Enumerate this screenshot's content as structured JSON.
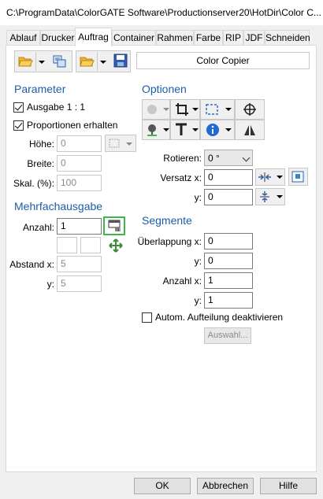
{
  "window": {
    "title": "C:\\ProgramData\\ColorGATE Software\\Productionserver20\\HotDir\\Color C..."
  },
  "tabs": [
    {
      "label": "Ablauf"
    },
    {
      "label": "Drucker"
    },
    {
      "label": "Auftrag"
    },
    {
      "label": "Container"
    },
    {
      "label": "Rahmen"
    },
    {
      "label": "Farbe"
    },
    {
      "label": "RIP"
    },
    {
      "label": "JDF"
    },
    {
      "label": "Schneiden"
    }
  ],
  "active_tab": "Auftrag",
  "toolbar": {
    "name_field": "Color Copier"
  },
  "parameter": {
    "heading": "Parameter",
    "ausgabe_label": "Ausgabe 1 : 1",
    "ausgabe_checked": true,
    "proportionen_label": "Proportionen erhalten",
    "proportionen_checked": true,
    "hoehe_label": "Höhe:",
    "hoehe_value": "0",
    "breite_label": "Breite:",
    "breite_value": "0",
    "skal_label": "Skal. (%):",
    "skal_value": "100"
  },
  "mehrfach": {
    "heading": "Mehrfachausgabe",
    "anzahl_label": "Anzahl:",
    "anzahl_value": "1",
    "abstand_x_label": "Abstand x:",
    "abstand_x_value": "5",
    "y_label": "y:",
    "y_value": "5"
  },
  "optionen": {
    "heading": "Optionen",
    "rotieren_label": "Rotieren:",
    "rotieren_value": "0 °",
    "versatz_x_label": "Versatz x:",
    "versatz_x_value": "0",
    "versatz_y_label": "y:",
    "versatz_y_value": "0"
  },
  "segmente": {
    "heading": "Segmente",
    "ueberlappung_x_label": "Überlappung x:",
    "ueberlappung_x_value": "0",
    "ueberlappung_y_label": "y:",
    "ueberlappung_y_value": "0",
    "anzahl_x_label": "Anzahl x:",
    "anzahl_x_value": "1",
    "anzahl_y_label": "y:",
    "anzahl_y_value": "1",
    "autom_label": "Autom. Aufteilung deaktivieren",
    "autom_checked": false,
    "auswahl_label": "Auswahl..."
  },
  "footer": {
    "ok": "OK",
    "cancel": "Abbrechen",
    "help": "Hilfe"
  },
  "colors": {
    "section_heading": "#1b5fa8",
    "highlight": "#3cb84a"
  }
}
